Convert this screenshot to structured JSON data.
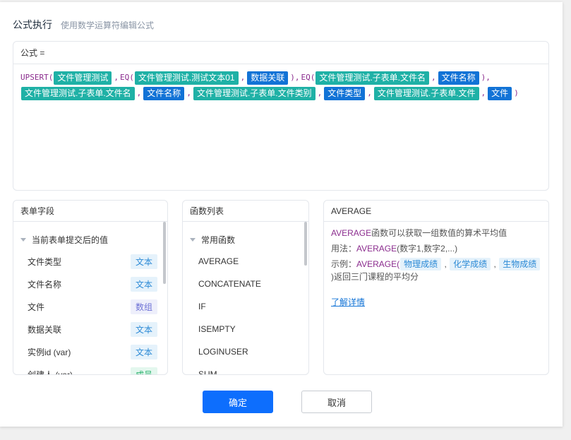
{
  "dialog": {
    "title": "公式执行",
    "subtitle": "使用数学运算符编辑公式"
  },
  "formula": {
    "label": "公式 =",
    "tokens": [
      {
        "k": "fn",
        "t": "UPSERT("
      },
      {
        "k": "tag",
        "c": "teal",
        "t": "文件管理测试"
      },
      {
        "k": "p",
        "t": ","
      },
      {
        "k": "fn",
        "t": "EQ("
      },
      {
        "k": "tag",
        "c": "teal",
        "t": "文件管理测试.测试文本01"
      },
      {
        "k": "p",
        "t": ","
      },
      {
        "k": "tag",
        "c": "blue",
        "t": "数据关联"
      },
      {
        "k": "p",
        "t": "),"
      },
      {
        "k": "fn",
        "t": "EQ("
      },
      {
        "k": "tag",
        "c": "teal",
        "t": "文件管理测试.子表单.文件名"
      },
      {
        "k": "p",
        "t": ","
      },
      {
        "k": "tag",
        "c": "blue",
        "t": "文件名称"
      },
      {
        "k": "p",
        "t": "),"
      },
      {
        "k": "br"
      },
      {
        "k": "tag",
        "c": "teal",
        "t": "文件管理测试.子表单.文件名"
      },
      {
        "k": "p",
        "t": ","
      },
      {
        "k": "tag",
        "c": "blue",
        "t": "文件名称"
      },
      {
        "k": "p",
        "t": ","
      },
      {
        "k": "tag",
        "c": "teal",
        "t": "文件管理测试.子表单.文件类别"
      },
      {
        "k": "p",
        "t": ","
      },
      {
        "k": "tag",
        "c": "blue",
        "t": "文件类型"
      },
      {
        "k": "p",
        "t": ","
      },
      {
        "k": "tag",
        "c": "teal",
        "t": "文件管理测试.子表单.文件"
      },
      {
        "k": "p",
        "t": ","
      },
      {
        "k": "tag",
        "c": "blue",
        "t": "文件"
      },
      {
        "k": "p",
        "t": ")"
      }
    ]
  },
  "fields_panel": {
    "title": "表单字段",
    "group": "当前表单提交后的值",
    "items": [
      {
        "name": "文件类型",
        "type": "文本",
        "kind": "text"
      },
      {
        "name": "文件名称",
        "type": "文本",
        "kind": "text"
      },
      {
        "name": "文件",
        "type": "数组",
        "kind": "array"
      },
      {
        "name": "数据关联",
        "type": "文本",
        "kind": "text"
      },
      {
        "name": "实例id (var)",
        "type": "文本",
        "kind": "text"
      },
      {
        "name": "创建人 (var)",
        "type": "成员",
        "kind": "member"
      }
    ]
  },
  "funcs_panel": {
    "title": "函数列表",
    "group": "常用函数",
    "items": [
      "AVERAGE",
      "CONCATENATE",
      "IF",
      "ISEMPTY",
      "LOGINUSER",
      "SUM"
    ]
  },
  "desc_panel": {
    "title": "AVERAGE",
    "fn_name": "AVERAGE",
    "desc_rest": "函数可以获取一组数值的算术平均值",
    "usage_label": "用法：",
    "usage_fn": "AVERAGE",
    "usage_args": "(数字1,数字2,...)",
    "example_label": "示例：",
    "example_fn": "AVERAGE(",
    "example_tags": [
      "物理成绩",
      "化学成绩",
      "生物成绩"
    ],
    "example_close": ")返回三门课程的平均分",
    "learn_more": "了解详情"
  },
  "buttons": {
    "ok": "确定",
    "cancel": "取消"
  },
  "colors": {
    "teal_tag": "#1fb1a6",
    "blue_tag": "#1273d6",
    "primary": "#0d6efd",
    "function_purple": "#8b2c8e"
  }
}
